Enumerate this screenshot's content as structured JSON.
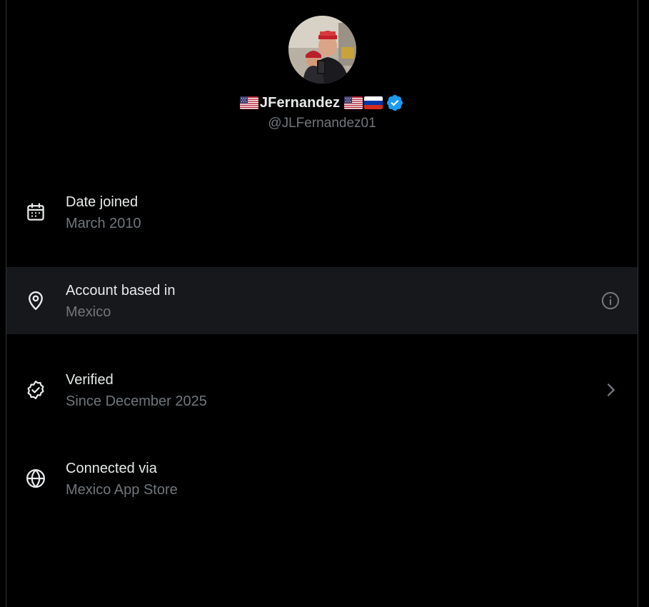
{
  "profile": {
    "name_prefix_flag": "us-flag-icon",
    "display_name": "JFernandez",
    "name_suffix_flags": [
      "us-flag-icon",
      "russia-flag-icon"
    ],
    "verified": true,
    "handle": "@JLFernandez01"
  },
  "rows": [
    {
      "icon": "calendar-icon",
      "title": "Date joined",
      "value": "March 2010",
      "action": ""
    },
    {
      "icon": "location-pin-icon",
      "title": "Account based in",
      "value": "Mexico",
      "action": "info-icon"
    },
    {
      "icon": "verified-badge-outline-icon",
      "title": "Verified",
      "value": "Since December 2025",
      "action": "chevron-right-icon"
    },
    {
      "icon": "globe-icon",
      "title": "Connected via",
      "value": "Mexico App Store",
      "action": ""
    }
  ],
  "colors": {
    "background": "#000000",
    "highlight_row": "#16181c",
    "primary_text": "#e7e9ea",
    "secondary_text": "#71767b",
    "verified_blue": "#1d9bf0"
  }
}
